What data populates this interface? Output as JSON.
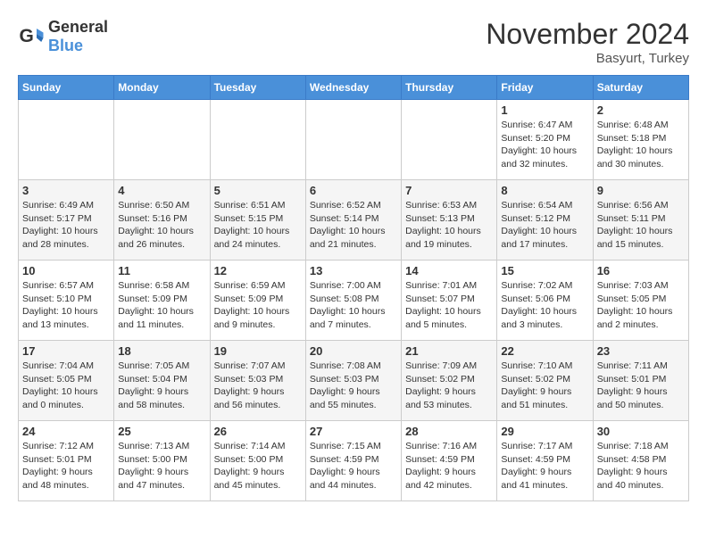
{
  "logo": {
    "general": "General",
    "blue": "Blue"
  },
  "title": "November 2024",
  "location": "Basyurt, Turkey",
  "days_of_week": [
    "Sunday",
    "Monday",
    "Tuesday",
    "Wednesday",
    "Thursday",
    "Friday",
    "Saturday"
  ],
  "weeks": [
    [
      {
        "day": "",
        "info": ""
      },
      {
        "day": "",
        "info": ""
      },
      {
        "day": "",
        "info": ""
      },
      {
        "day": "",
        "info": ""
      },
      {
        "day": "",
        "info": ""
      },
      {
        "day": "1",
        "info": "Sunrise: 6:47 AM\nSunset: 5:20 PM\nDaylight: 10 hours and 32 minutes."
      },
      {
        "day": "2",
        "info": "Sunrise: 6:48 AM\nSunset: 5:18 PM\nDaylight: 10 hours and 30 minutes."
      }
    ],
    [
      {
        "day": "3",
        "info": "Sunrise: 6:49 AM\nSunset: 5:17 PM\nDaylight: 10 hours and 28 minutes."
      },
      {
        "day": "4",
        "info": "Sunrise: 6:50 AM\nSunset: 5:16 PM\nDaylight: 10 hours and 26 minutes."
      },
      {
        "day": "5",
        "info": "Sunrise: 6:51 AM\nSunset: 5:15 PM\nDaylight: 10 hours and 24 minutes."
      },
      {
        "day": "6",
        "info": "Sunrise: 6:52 AM\nSunset: 5:14 PM\nDaylight: 10 hours and 21 minutes."
      },
      {
        "day": "7",
        "info": "Sunrise: 6:53 AM\nSunset: 5:13 PM\nDaylight: 10 hours and 19 minutes."
      },
      {
        "day": "8",
        "info": "Sunrise: 6:54 AM\nSunset: 5:12 PM\nDaylight: 10 hours and 17 minutes."
      },
      {
        "day": "9",
        "info": "Sunrise: 6:56 AM\nSunset: 5:11 PM\nDaylight: 10 hours and 15 minutes."
      }
    ],
    [
      {
        "day": "10",
        "info": "Sunrise: 6:57 AM\nSunset: 5:10 PM\nDaylight: 10 hours and 13 minutes."
      },
      {
        "day": "11",
        "info": "Sunrise: 6:58 AM\nSunset: 5:09 PM\nDaylight: 10 hours and 11 minutes."
      },
      {
        "day": "12",
        "info": "Sunrise: 6:59 AM\nSunset: 5:09 PM\nDaylight: 10 hours and 9 minutes."
      },
      {
        "day": "13",
        "info": "Sunrise: 7:00 AM\nSunset: 5:08 PM\nDaylight: 10 hours and 7 minutes."
      },
      {
        "day": "14",
        "info": "Sunrise: 7:01 AM\nSunset: 5:07 PM\nDaylight: 10 hours and 5 minutes."
      },
      {
        "day": "15",
        "info": "Sunrise: 7:02 AM\nSunset: 5:06 PM\nDaylight: 10 hours and 3 minutes."
      },
      {
        "day": "16",
        "info": "Sunrise: 7:03 AM\nSunset: 5:05 PM\nDaylight: 10 hours and 2 minutes."
      }
    ],
    [
      {
        "day": "17",
        "info": "Sunrise: 7:04 AM\nSunset: 5:05 PM\nDaylight: 10 hours and 0 minutes."
      },
      {
        "day": "18",
        "info": "Sunrise: 7:05 AM\nSunset: 5:04 PM\nDaylight: 9 hours and 58 minutes."
      },
      {
        "day": "19",
        "info": "Sunrise: 7:07 AM\nSunset: 5:03 PM\nDaylight: 9 hours and 56 minutes."
      },
      {
        "day": "20",
        "info": "Sunrise: 7:08 AM\nSunset: 5:03 PM\nDaylight: 9 hours and 55 minutes."
      },
      {
        "day": "21",
        "info": "Sunrise: 7:09 AM\nSunset: 5:02 PM\nDaylight: 9 hours and 53 minutes."
      },
      {
        "day": "22",
        "info": "Sunrise: 7:10 AM\nSunset: 5:02 PM\nDaylight: 9 hours and 51 minutes."
      },
      {
        "day": "23",
        "info": "Sunrise: 7:11 AM\nSunset: 5:01 PM\nDaylight: 9 hours and 50 minutes."
      }
    ],
    [
      {
        "day": "24",
        "info": "Sunrise: 7:12 AM\nSunset: 5:01 PM\nDaylight: 9 hours and 48 minutes."
      },
      {
        "day": "25",
        "info": "Sunrise: 7:13 AM\nSunset: 5:00 PM\nDaylight: 9 hours and 47 minutes."
      },
      {
        "day": "26",
        "info": "Sunrise: 7:14 AM\nSunset: 5:00 PM\nDaylight: 9 hours and 45 minutes."
      },
      {
        "day": "27",
        "info": "Sunrise: 7:15 AM\nSunset: 4:59 PM\nDaylight: 9 hours and 44 minutes."
      },
      {
        "day": "28",
        "info": "Sunrise: 7:16 AM\nSunset: 4:59 PM\nDaylight: 9 hours and 42 minutes."
      },
      {
        "day": "29",
        "info": "Sunrise: 7:17 AM\nSunset: 4:59 PM\nDaylight: 9 hours and 41 minutes."
      },
      {
        "day": "30",
        "info": "Sunrise: 7:18 AM\nSunset: 4:58 PM\nDaylight: 9 hours and 40 minutes."
      }
    ]
  ]
}
